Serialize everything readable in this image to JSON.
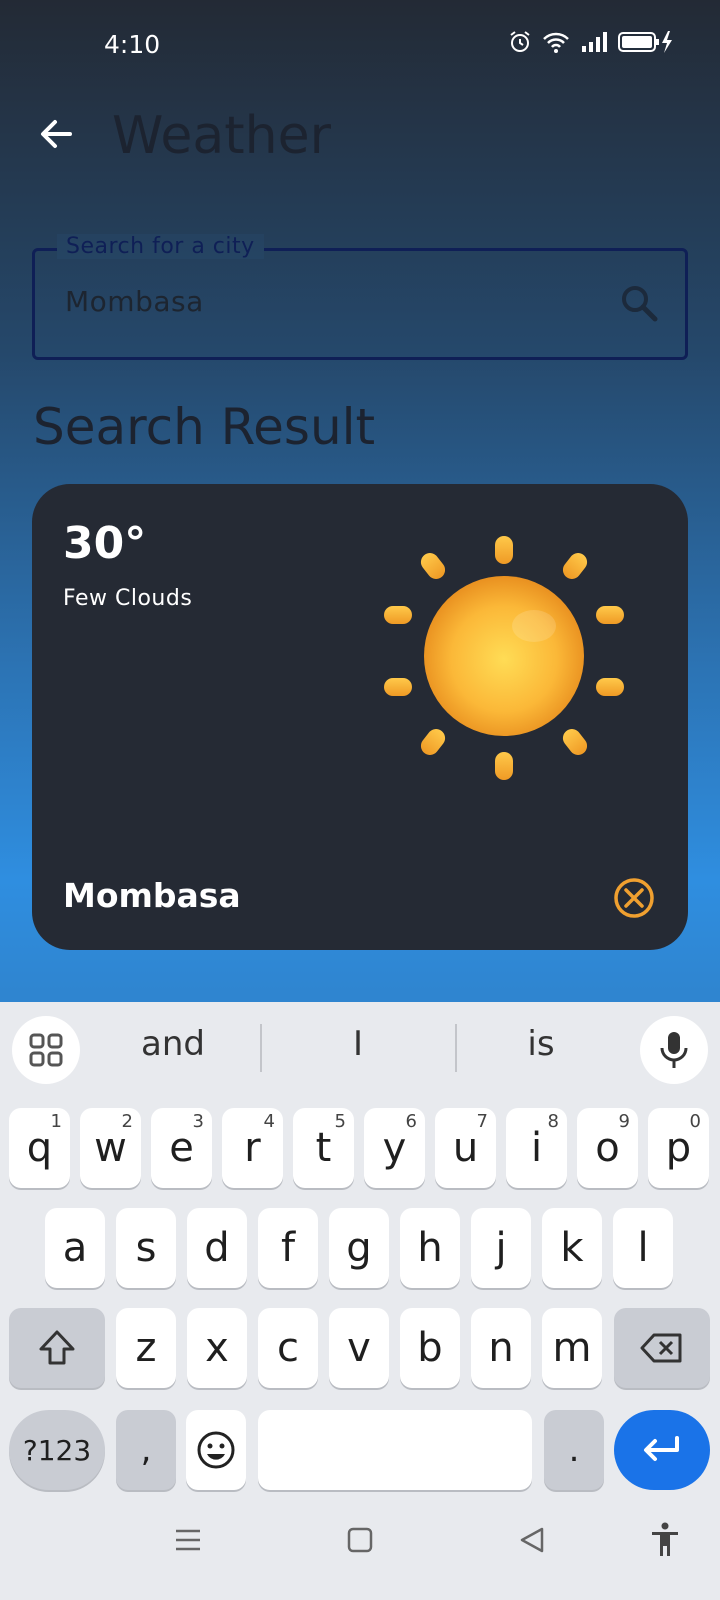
{
  "status_bar": {
    "time": "4:10"
  },
  "app_bar": {
    "title": "Weather"
  },
  "search": {
    "label": "Search for a city",
    "value": "Mombasa"
  },
  "section": {
    "title": "Search Result"
  },
  "card": {
    "temperature": "30°",
    "condition": "Few Clouds",
    "city": "Mombasa"
  },
  "keyboard": {
    "suggestions": [
      "and",
      "I",
      "is"
    ],
    "row1": [
      {
        "k": "q",
        "h": "1"
      },
      {
        "k": "w",
        "h": "2"
      },
      {
        "k": "e",
        "h": "3"
      },
      {
        "k": "r",
        "h": "4"
      },
      {
        "k": "t",
        "h": "5"
      },
      {
        "k": "y",
        "h": "6"
      },
      {
        "k": "u",
        "h": "7"
      },
      {
        "k": "i",
        "h": "8"
      },
      {
        "k": "o",
        "h": "9"
      },
      {
        "k": "p",
        "h": "0"
      }
    ],
    "row2": [
      "a",
      "s",
      "d",
      "f",
      "g",
      "h",
      "j",
      "k",
      "l"
    ],
    "row3": [
      "z",
      "x",
      "c",
      "v",
      "b",
      "n",
      "m"
    ],
    "symbols_label": "?123",
    "comma": ",",
    "period": "."
  },
  "colors": {
    "accent": "#f5a623",
    "enter_key": "#1a73e8",
    "card": "#252a34"
  }
}
